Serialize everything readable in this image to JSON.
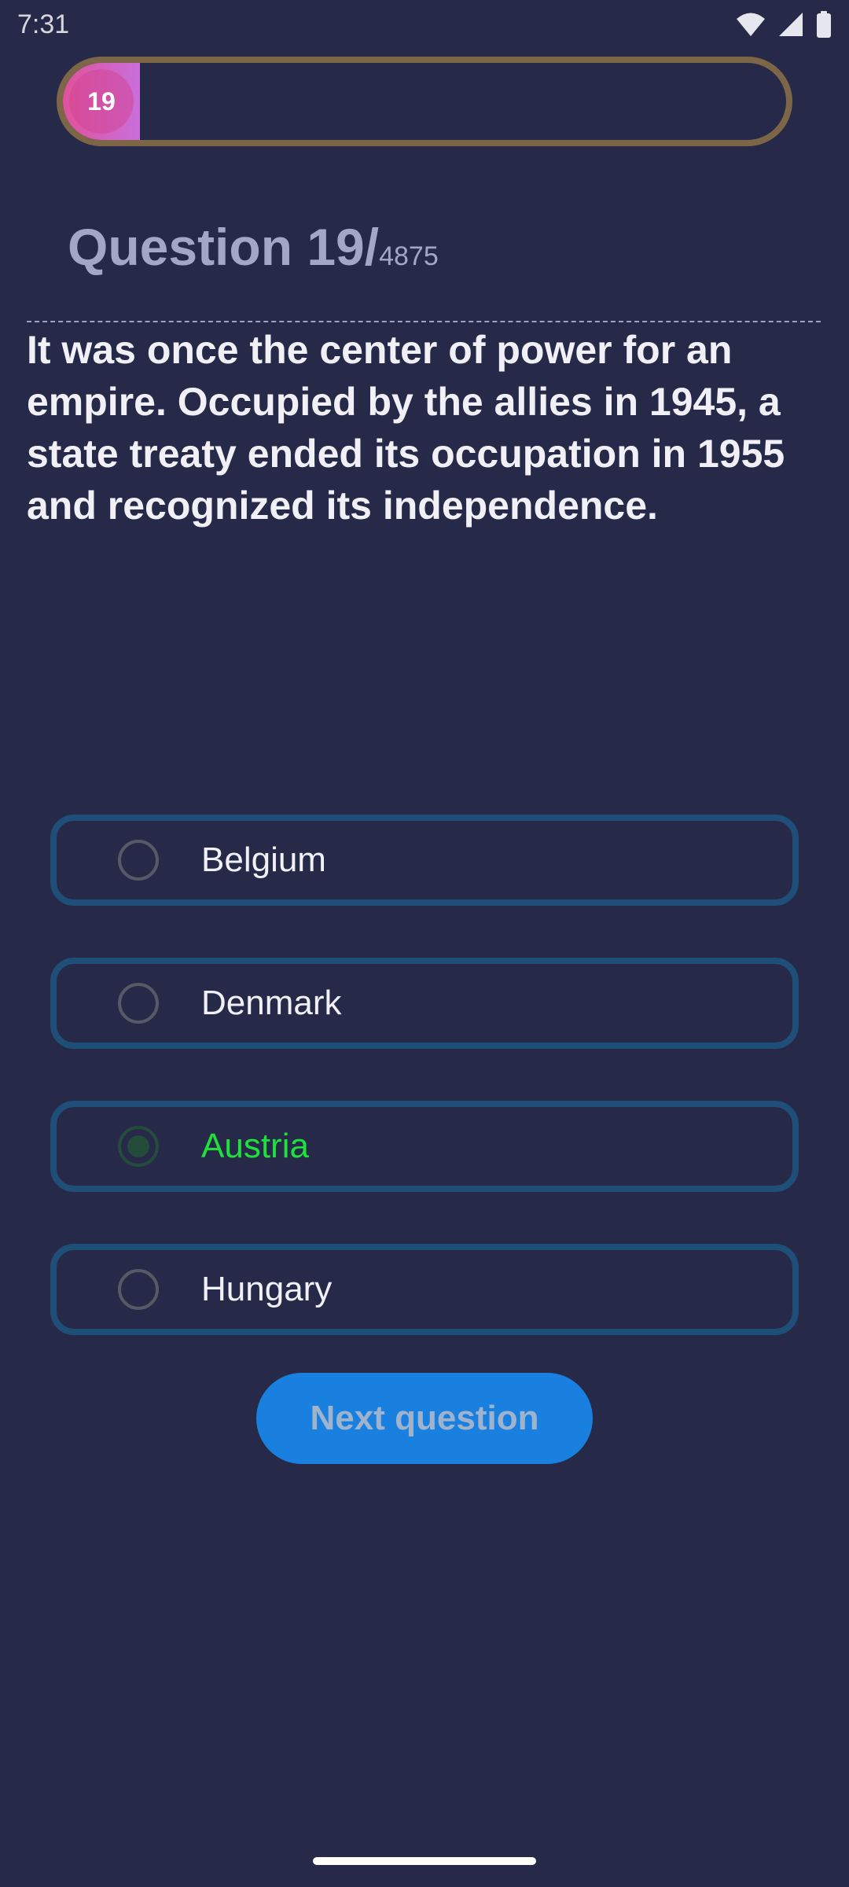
{
  "status_bar": {
    "time": "7:31",
    "icons": [
      "wifi-icon",
      "cellular-signal-icon",
      "battery-icon"
    ]
  },
  "progress": {
    "current": "19",
    "fraction": 0.0039
  },
  "question": {
    "label": "Question 19/",
    "total": "4875",
    "text": "It was once the center of power for an empire.  Occupied by the allies in 1945, a state treaty ended its occupation in 1955 and recognized its independence."
  },
  "options": [
    {
      "label": "Belgium",
      "selected": false
    },
    {
      "label": "Denmark",
      "selected": false
    },
    {
      "label": "Austria",
      "selected": true
    },
    {
      "label": "Hungary",
      "selected": false
    }
  ],
  "next_button": {
    "label": "Next question"
  },
  "colors": {
    "background": "#262a48",
    "progress_border": "#7d6647",
    "progress_fill_start": "#e0529a",
    "progress_fill_end": "#c96fdd",
    "option_border": "#1f4e79",
    "selected_text": "#1fe03c",
    "button": "#1a80e0"
  }
}
